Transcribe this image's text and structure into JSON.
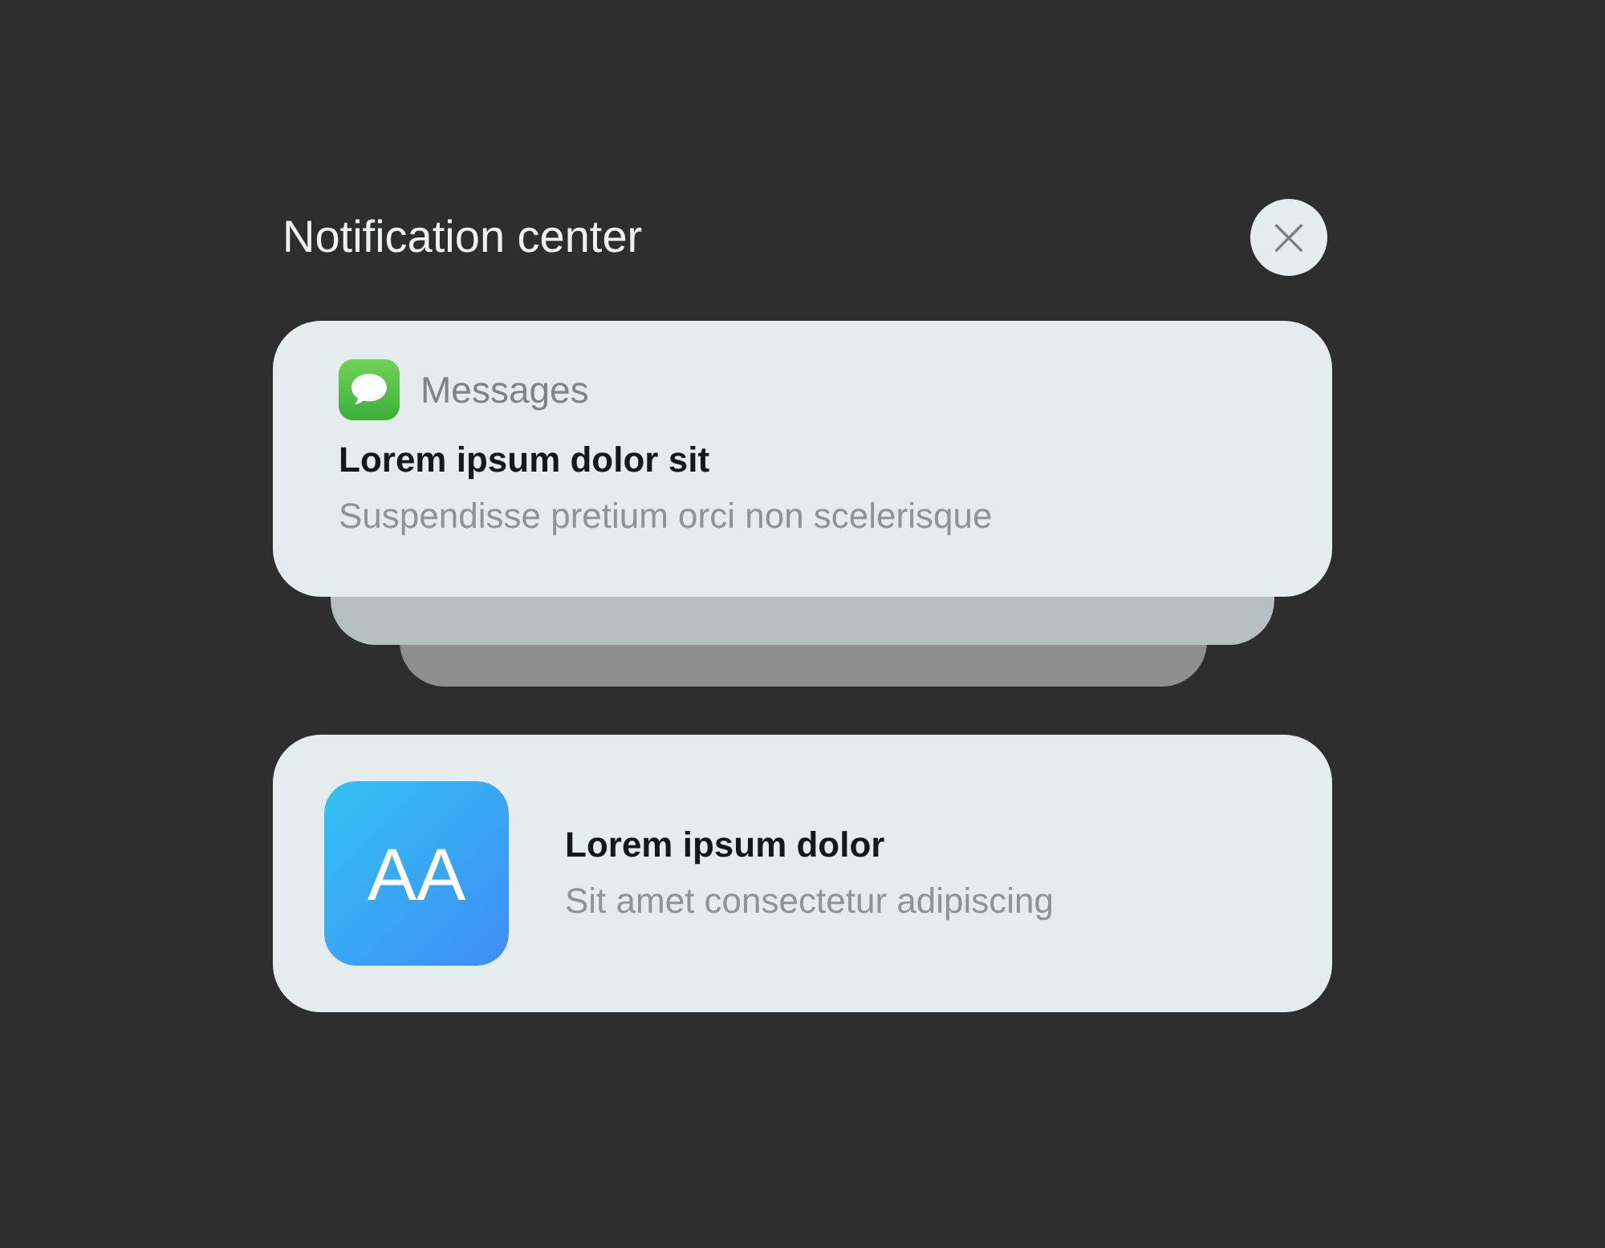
{
  "title": "Notification center",
  "close_button": {
    "label": "×"
  },
  "notifications": [
    {
      "kind": "grouped",
      "app": "Messages",
      "title": "Lorem ipsum dolor sit",
      "body": "Suspendisse pretium orci non scelerisque"
    },
    {
      "kind": "app",
      "icon_text": "AA",
      "title": "Lorem ipsum dolor",
      "body": "Sit amet consectetur adipiscing"
    }
  ]
}
